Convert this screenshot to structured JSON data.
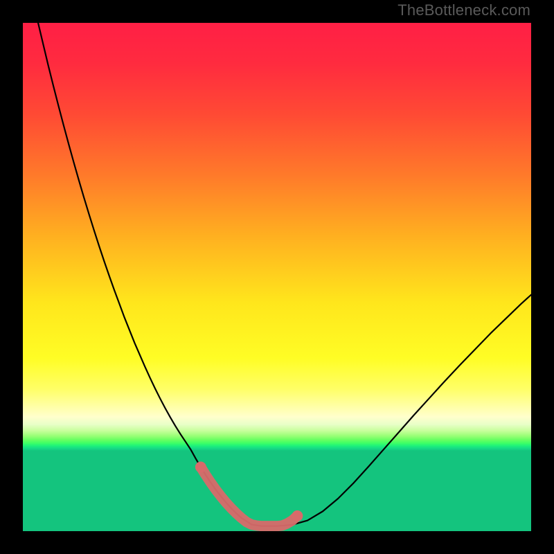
{
  "watermark": "TheBottleneck.com",
  "chart_data": {
    "type": "line",
    "title": "",
    "xlabel": "",
    "ylabel": "",
    "xlim": [
      0,
      100
    ],
    "ylim": [
      0,
      100
    ],
    "series": [
      {
        "name": "bottleneck-curve",
        "x": [
          3,
          4,
          5,
          6,
          7,
          8,
          9,
          10,
          11,
          12,
          13,
          14,
          15,
          16,
          17,
          18,
          19,
          20,
          21,
          22,
          23,
          24,
          25,
          26,
          27,
          28,
          29,
          30,
          31,
          32,
          33,
          34,
          35,
          36,
          37,
          38,
          39,
          40,
          41,
          42,
          43,
          45,
          47,
          50,
          53,
          56,
          59,
          62,
          65,
          68,
          71,
          74,
          77,
          80,
          83,
          86,
          89,
          92,
          95,
          98,
          100
        ],
        "y": [
          100,
          95.8,
          91.6,
          87.6,
          83.7,
          79.9,
          76.2,
          72.6,
          69.1,
          65.7,
          62.4,
          59.2,
          56.1,
          53.1,
          50.2,
          47.4,
          44.7,
          42,
          39.5,
          37,
          34.7,
          32.4,
          30.2,
          28.1,
          26.1,
          24.2,
          22.4,
          20.7,
          19.1,
          17.6,
          16.1,
          14.3,
          12.6,
          11,
          9.5,
          8.1,
          6.8,
          5.6,
          4.5,
          3.5,
          2.6,
          1.3,
          1,
          1,
          1.25,
          2.1,
          3.9,
          6.4,
          9.4,
          12.7,
          16.1,
          19.5,
          22.9,
          26.2,
          29.5,
          32.7,
          35.8,
          38.9,
          41.8,
          44.7,
          46.5
        ]
      },
      {
        "name": "highlight-segment",
        "x": [
          35,
          36,
          37,
          38,
          39,
          40,
          41,
          42,
          43,
          44,
          45,
          46,
          47,
          48,
          49,
          50,
          51,
          52,
          53,
          54
        ],
        "y": [
          12.6,
          11,
          9.5,
          8.1,
          6.8,
          5.6,
          4.5,
          3.5,
          2.6,
          1.8,
          1.3,
          1.1,
          1,
          1,
          1,
          1,
          1.1,
          1.5,
          2.1,
          3
        ]
      }
    ],
    "highlight_dots": {
      "x": [
        35,
        54
      ],
      "y": [
        12.6,
        3
      ]
    }
  }
}
